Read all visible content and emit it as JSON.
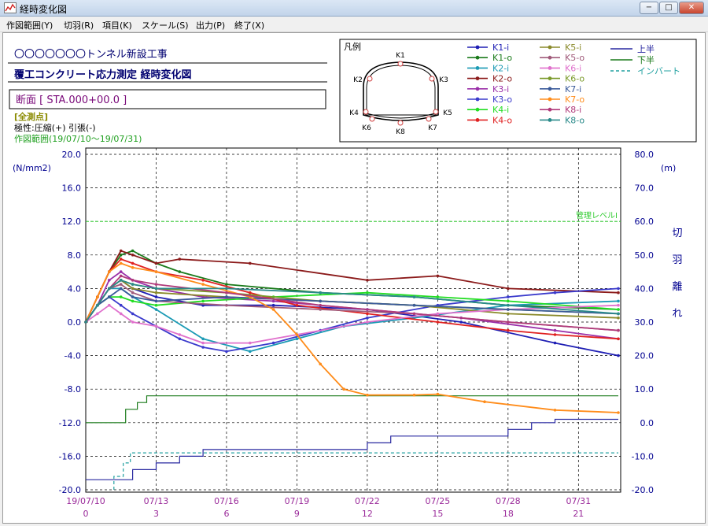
{
  "window": {
    "title": "経時変化図",
    "minimize_glyph": "−",
    "maximize_glyph": "□",
    "close_glyph": "✕",
    "icon": "chart-app-icon"
  },
  "menu": [
    {
      "label": "作図範囲(Y)"
    },
    {
      "label": "切羽(R)"
    },
    {
      "label": "項目(K)"
    },
    {
      "label": "スケール(S)"
    },
    {
      "label": "出力(P)"
    },
    {
      "label": "終了(X)"
    }
  ],
  "header": {
    "project_title": "〇〇〇〇〇〇〇トンネル新設工事",
    "chart_title": "覆工コンクリート応力測定 経時変化図",
    "section_label": "断面 [ STA.000+00.0 ]",
    "points_label": "[全測点]",
    "polarity_label": "極性:圧縮(+) 引張(-)",
    "range_label": "作図範囲(19/07/10〜19/07/31)"
  },
  "legend_box": {
    "title": "凡例",
    "point_labels": [
      "K1",
      "K2",
      "K3",
      "K4",
      "K5",
      "K6",
      "K7",
      "K8"
    ]
  },
  "chart_data": {
    "type": "line",
    "left_axis": {
      "label": "(N/mm2)",
      "min": -20,
      "max": 20,
      "ticks": [
        "20.0",
        "16.0",
        "12.0",
        "8.0",
        "4.0",
        "0.0",
        "-4.0",
        "-8.0",
        "-12.0",
        "-16.0",
        "-20.0"
      ]
    },
    "right_axis": {
      "label": "(m)",
      "vertical_label": [
        "切",
        "羽",
        "離",
        "れ"
      ],
      "min": -20,
      "max": 80,
      "ticks": [
        "80.0",
        "70.0",
        "60.0",
        "50.0",
        "40.0",
        "30.0",
        "20.0",
        "10.0",
        "0.0",
        "-10.0",
        "-20.0"
      ]
    },
    "x_axis": {
      "min_day": 0,
      "max_day": 22.8,
      "date_labels": [
        "19/07/10",
        "07/13",
        "07/16",
        "07/19",
        "07/22",
        "07/25",
        "07/28",
        "07/31"
      ],
      "day_labels": [
        "0",
        "3",
        "6",
        "9",
        "12",
        "15",
        "18",
        "21"
      ]
    },
    "grid": true,
    "reference_line": {
      "label": "管理レベルⅠ",
      "value": 12,
      "color": "#33cc33"
    },
    "series": [
      {
        "name": "K1-i",
        "color": "#1f1fb4",
        "points": [
          [
            0,
            0
          ],
          [
            0.5,
            2
          ],
          [
            1,
            4
          ],
          [
            1.5,
            5
          ],
          [
            2,
            4
          ],
          [
            3,
            3
          ],
          [
            5,
            2
          ],
          [
            8,
            2
          ],
          [
            12,
            1.5
          ],
          [
            16,
            0
          ],
          [
            20,
            -2.5
          ],
          [
            22.7,
            -4
          ]
        ]
      },
      {
        "name": "K1-o",
        "color": "#1a7a1a",
        "points": [
          [
            0,
            0
          ],
          [
            0.5,
            3
          ],
          [
            1,
            6
          ],
          [
            1.5,
            8
          ],
          [
            2,
            8.5
          ],
          [
            3,
            7
          ],
          [
            4,
            6
          ],
          [
            6,
            4.5
          ],
          [
            10,
            3.5
          ],
          [
            14,
            3
          ],
          [
            18,
            2
          ],
          [
            22.7,
            1.5
          ]
        ]
      },
      {
        "name": "K2-i",
        "color": "#1a9ab4",
        "points": [
          [
            0,
            0
          ],
          [
            0.5,
            2
          ],
          [
            1,
            4
          ],
          [
            1.5,
            4
          ],
          [
            2,
            3
          ],
          [
            3,
            1.5
          ],
          [
            5,
            -2
          ],
          [
            7,
            -3.5
          ],
          [
            9,
            -2
          ],
          [
            11,
            -0.5
          ],
          [
            14,
            0.5
          ],
          [
            18,
            2
          ],
          [
            22.7,
            2.5
          ]
        ]
      },
      {
        "name": "K2-o",
        "color": "#8b1a1a",
        "points": [
          [
            0,
            0
          ],
          [
            0.5,
            3
          ],
          [
            1,
            6
          ],
          [
            1.5,
            8.5
          ],
          [
            2,
            8
          ],
          [
            3,
            7
          ],
          [
            4,
            7.5
          ],
          [
            7,
            7
          ],
          [
            12,
            5
          ],
          [
            15,
            5.5
          ],
          [
            18,
            4
          ],
          [
            22.7,
            3.5
          ]
        ]
      },
      {
        "name": "K3-i",
        "color": "#9a2ea8",
        "points": [
          [
            0,
            0
          ],
          [
            0.5,
            2
          ],
          [
            1,
            5
          ],
          [
            1.5,
            6
          ],
          [
            2,
            5
          ],
          [
            3,
            4
          ],
          [
            5,
            3
          ],
          [
            8,
            2.5
          ],
          [
            12,
            1.5
          ],
          [
            16,
            0.5
          ],
          [
            20,
            -1
          ],
          [
            22.7,
            -2
          ]
        ]
      },
      {
        "name": "K3-o",
        "color": "#3a3acc",
        "points": [
          [
            0,
            0
          ],
          [
            0.5,
            2
          ],
          [
            1,
            3
          ],
          [
            1.5,
            2
          ],
          [
            2,
            1
          ],
          [
            3,
            -0.5
          ],
          [
            4,
            -2
          ],
          [
            5,
            -3
          ],
          [
            6,
            -3.5
          ],
          [
            8,
            -2.5
          ],
          [
            10,
            -1
          ],
          [
            12,
            0.5
          ],
          [
            15,
            2
          ],
          [
            18,
            3
          ],
          [
            20,
            3.5
          ],
          [
            22.7,
            4
          ]
        ]
      },
      {
        "name": "K4-i",
        "color": "#22dd22",
        "points": [
          [
            0,
            0
          ],
          [
            0.5,
            2
          ],
          [
            1,
            3
          ],
          [
            1.5,
            3
          ],
          [
            2,
            2.5
          ],
          [
            3,
            2
          ],
          [
            5,
            2.5
          ],
          [
            8,
            3
          ],
          [
            12,
            3.5
          ],
          [
            15,
            3
          ],
          [
            18,
            2.5
          ],
          [
            22.7,
            1.5
          ]
        ]
      },
      {
        "name": "K4-o",
        "color": "#e02020",
        "points": [
          [
            0,
            0
          ],
          [
            0.5,
            3
          ],
          [
            1,
            6
          ],
          [
            1.5,
            7.5
          ],
          [
            2,
            7
          ],
          [
            3,
            6
          ],
          [
            5,
            5
          ],
          [
            7,
            3.5
          ],
          [
            9,
            2
          ],
          [
            12,
            1
          ],
          [
            15,
            0
          ],
          [
            18,
            -1
          ],
          [
            20,
            -1.5
          ],
          [
            22.7,
            -2
          ]
        ]
      },
      {
        "name": "K5-i",
        "color": "#8a8a2a",
        "points": [
          [
            0,
            0
          ],
          [
            0.5,
            2
          ],
          [
            1,
            4
          ],
          [
            1.5,
            5
          ],
          [
            2,
            4
          ],
          [
            3,
            3.5
          ],
          [
            6,
            3
          ],
          [
            10,
            2.5
          ],
          [
            14,
            2
          ],
          [
            18,
            1
          ],
          [
            22.7,
            0.5
          ]
        ]
      },
      {
        "name": "K5-o",
        "color": "#a05a7a",
        "points": [
          [
            0,
            0
          ],
          [
            0.5,
            2
          ],
          [
            1,
            4
          ],
          [
            1.5,
            4.5
          ],
          [
            2,
            3.5
          ],
          [
            3,
            2.5
          ],
          [
            6,
            2
          ],
          [
            10,
            1.5
          ],
          [
            14,
            1
          ],
          [
            18,
            0
          ],
          [
            22.7,
            -1
          ]
        ]
      },
      {
        "name": "K6-i",
        "color": "#e070cc",
        "points": [
          [
            0,
            0
          ],
          [
            0.5,
            1
          ],
          [
            1,
            2
          ],
          [
            1.5,
            1
          ],
          [
            2,
            0
          ],
          [
            3,
            -0.5
          ],
          [
            4,
            -1.5
          ],
          [
            5,
            -2.5
          ],
          [
            7,
            -2.5
          ],
          [
            9,
            -1.5
          ],
          [
            12,
            0
          ],
          [
            15,
            1
          ],
          [
            18,
            1.5
          ],
          [
            22.7,
            2
          ]
        ]
      },
      {
        "name": "K6-o",
        "color": "#7a9a2a",
        "points": [
          [
            0,
            0
          ],
          [
            0.5,
            2
          ],
          [
            1,
            4
          ],
          [
            1.5,
            5
          ],
          [
            2,
            4.5
          ],
          [
            3,
            4
          ],
          [
            6,
            3.5
          ],
          [
            10,
            2.5
          ],
          [
            14,
            2
          ],
          [
            18,
            1.5
          ],
          [
            22.7,
            1
          ]
        ]
      },
      {
        "name": "K7-i",
        "color": "#3a5a9a",
        "points": [
          [
            0,
            0
          ],
          [
            0.5,
            2
          ],
          [
            1,
            3
          ],
          [
            1.5,
            4
          ],
          [
            2,
            3
          ],
          [
            3,
            2.5
          ],
          [
            6,
            3
          ],
          [
            10,
            2.5
          ],
          [
            14,
            2
          ],
          [
            18,
            1.5
          ],
          [
            22.7,
            1
          ]
        ]
      },
      {
        "name": "K7-o",
        "color": "#ff8c1a",
        "points": [
          [
            0,
            0
          ],
          [
            0.5,
            3
          ],
          [
            1,
            6
          ],
          [
            1.5,
            7
          ],
          [
            2,
            6.5
          ],
          [
            3,
            6
          ],
          [
            5,
            4.5
          ],
          [
            7,
            3
          ],
          [
            8,
            1.5
          ],
          [
            9,
            -1.5
          ],
          [
            10,
            -5
          ],
          [
            11,
            -8
          ],
          [
            12,
            -8.7
          ],
          [
            14,
            -8.7
          ],
          [
            15,
            -8.6
          ],
          [
            17,
            -9.5
          ],
          [
            20,
            -10.5
          ],
          [
            22.7,
            -10.8
          ]
        ]
      },
      {
        "name": "K8-i",
        "color": "#b03a7a",
        "points": [
          [
            0,
            0
          ],
          [
            0.5,
            2
          ],
          [
            1,
            4
          ],
          [
            1.5,
            5.5
          ],
          [
            2,
            5
          ],
          [
            3,
            4.5
          ],
          [
            6,
            3.5
          ],
          [
            10,
            2
          ],
          [
            14,
            1
          ],
          [
            18,
            0
          ],
          [
            22.7,
            -1
          ]
        ]
      },
      {
        "name": "K8-o",
        "color": "#2a8a8a",
        "points": [
          [
            0,
            0
          ],
          [
            0.5,
            2
          ],
          [
            1,
            4
          ],
          [
            1.5,
            5
          ],
          [
            2,
            4.5
          ],
          [
            3,
            4
          ],
          [
            6,
            4
          ],
          [
            10,
            3.5
          ],
          [
            14,
            3
          ],
          [
            18,
            2
          ],
          [
            22.7,
            1
          ]
        ]
      }
    ],
    "face_series": [
      {
        "name": "上半",
        "color": "#2828a0",
        "style": "solid",
        "points": [
          [
            0,
            -17
          ],
          [
            2,
            -17
          ],
          [
            2,
            -14
          ],
          [
            3,
            -14
          ],
          [
            3,
            -12
          ],
          [
            4,
            -12
          ],
          [
            4,
            -10
          ],
          [
            5,
            -10
          ],
          [
            5,
            -8
          ],
          [
            10,
            -8
          ],
          [
            12,
            -8
          ],
          [
            12,
            -6
          ],
          [
            13,
            -6
          ],
          [
            13,
            -4
          ],
          [
            18,
            -4
          ],
          [
            18,
            -2
          ],
          [
            19,
            -2
          ],
          [
            19,
            0
          ],
          [
            20,
            0
          ],
          [
            20,
            1
          ],
          [
            22.7,
            1
          ]
        ]
      },
      {
        "name": "下半",
        "color": "#1a7a1a",
        "style": "solid",
        "points": [
          [
            0,
            0
          ],
          [
            1.7,
            0
          ],
          [
            1.7,
            4
          ],
          [
            2.2,
            4
          ],
          [
            2.2,
            6
          ],
          [
            2.6,
            6
          ],
          [
            2.6,
            8
          ],
          [
            22.7,
            8
          ]
        ]
      },
      {
        "name": "インバート",
        "color": "#20a0a0",
        "style": "dashed",
        "points": [
          [
            1.2,
            -20
          ],
          [
            1.2,
            -16
          ],
          [
            1.6,
            -16
          ],
          [
            1.6,
            -12
          ],
          [
            1.9,
            -12
          ],
          [
            1.9,
            -9
          ],
          [
            22.7,
            -9
          ]
        ]
      }
    ]
  }
}
